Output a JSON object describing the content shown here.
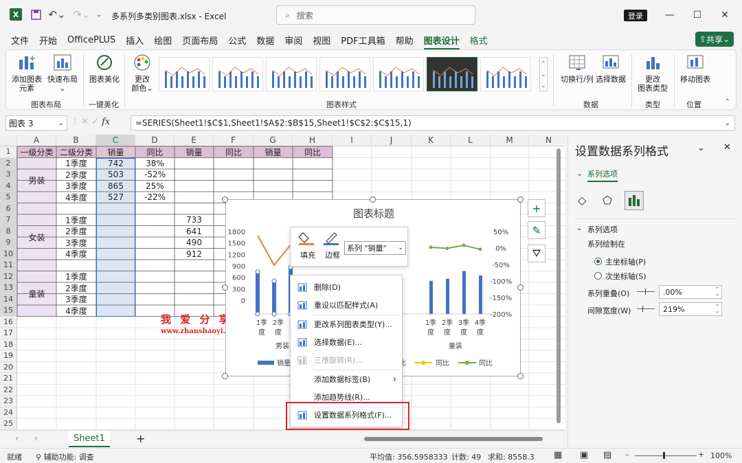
{
  "titlebar": {
    "app_icon": "excel-icon",
    "filename": "多系列多类别图表.xlsx",
    "separator": "-",
    "app_name": "Excel",
    "search_placeholder": "搜索",
    "login_label": "登录"
  },
  "menu": {
    "items": [
      "文件",
      "开始",
      "OfficePLUS",
      "插入",
      "绘图",
      "页面布局",
      "公式",
      "数据",
      "审阅",
      "视图",
      "PDF工具箱",
      "帮助",
      "图表设计",
      "格式"
    ],
    "active": "图表设计",
    "share_label": "共享"
  },
  "ribbon": {
    "add_element": [
      "添加图表",
      "元素"
    ],
    "quick_layout": [
      "快速布局"
    ],
    "beautify": [
      "图表美化"
    ],
    "change_color": [
      "更改",
      "颜色"
    ],
    "switch_rowcol": "切换行/列",
    "select_data": "选择数据",
    "change_type": [
      "更改",
      "图表类型"
    ],
    "move_chart": "移动图表",
    "groups": {
      "layout": "图表布局",
      "beautify": "一键美化",
      "styles": "图表样式",
      "data": "数据",
      "type": "类型",
      "location": "位置"
    }
  },
  "formula_bar": {
    "name_box": "图表 3",
    "fx": "fx",
    "formula": "=SERIES(Sheet1!$C$1,Sheet1!$A$2:$B$15,Sheet1!$C$2:$C$15,1)"
  },
  "sheet": {
    "columns": [
      "A",
      "B",
      "C",
      "D",
      "E",
      "F",
      "G",
      "H",
      "I",
      "J",
      "K",
      "L",
      "M",
      "N"
    ],
    "rows": [
      "1",
      "2",
      "3",
      "4",
      "5",
      "6",
      "7",
      "8",
      "9",
      "10",
      "11",
      "12",
      "13",
      "14",
      "15",
      "16",
      "17",
      "18",
      "19",
      "20",
      "21",
      "22",
      "23",
      "24",
      "25"
    ],
    "header": [
      "一级分类",
      "二级分类",
      "销量",
      "同比",
      "销量",
      "同比",
      "销量",
      "同比"
    ],
    "groups": [
      "男装",
      "女装",
      "童装"
    ],
    "quarters": [
      "1季度",
      "2季度",
      "3季度",
      "4季度"
    ],
    "men_sales": [
      "742",
      "503",
      "865",
      "527"
    ],
    "men_yoy": [
      "38%",
      "-52%",
      "25%",
      "-22%"
    ],
    "women_sales": [
      "733",
      "641",
      "490",
      "912"
    ],
    "watermark_cn": "我 爱 分 享 网",
    "watermark_url": "www.zhanshaoyi.com"
  },
  "chart_data": {
    "type": "bar",
    "title": "图表标题",
    "y_left_ticks": [
      "1800",
      "1500",
      "1200",
      "900",
      "600",
      "300",
      "0"
    ],
    "y_right_ticks": [
      "50%",
      "0%",
      "-50%",
      "-100%",
      "-150%",
      "-200%"
    ],
    "ylim": [
      0,
      1800
    ],
    "y2lim": [
      -2,
      0.5
    ],
    "category_groups": [
      "男装",
      "童装"
    ],
    "categories": [
      "1季",
      "2季",
      "3季",
      "4季"
    ],
    "categories_line2": "度",
    "series": [
      {
        "name": "销量",
        "color": "#4472c4",
        "values": [
          742,
          503,
          865,
          null
        ]
      },
      {
        "name": "同比",
        "color": "#ed7d31",
        "values": [
          0.38,
          -0.52,
          null,
          null
        ]
      },
      {
        "name": "销量",
        "color": "#4472c4",
        "values": [
          null,
          null,
          null,
          null
        ]
      },
      {
        "name": "同比",
        "color": "#ffc000",
        "values": [
          null,
          null,
          null,
          null
        ]
      },
      {
        "name": "同比",
        "color": "#70ad47",
        "values": [
          0.02,
          -0.01,
          0.08,
          -0.04
        ]
      }
    ],
    "legend_labels": [
      "销量",
      "比",
      "同比",
      "同比"
    ],
    "legend_position": "bottom"
  },
  "mini_toolbar": {
    "fill": "填充",
    "border": "边框",
    "series_select": "系列 \"销量\""
  },
  "context_menu": [
    {
      "label": "删除(D)",
      "icon": "delete-icon",
      "disabled": false
    },
    {
      "label": "重设以匹配样式(A)",
      "icon": "reset-style-icon",
      "disabled": false
    },
    {
      "label": "更改系列图表类型(Y)...",
      "icon": "chart-type-icon",
      "disabled": false
    },
    {
      "label": "选择数据(E)...",
      "icon": "select-data-icon",
      "disabled": false
    },
    {
      "label": "三维旋转(R)...",
      "icon": "rotate-3d-icon",
      "disabled": true
    },
    {
      "label": "添加数据标签(B)",
      "icon": "",
      "disabled": false
    },
    {
      "label": "添加趋势线(R)...",
      "icon": "",
      "disabled": false
    },
    {
      "label": "设置数据系列格式(F)...",
      "icon": "format-series-icon",
      "disabled": false
    }
  ],
  "pane": {
    "title": "设置数据系列格式",
    "section": "系列选项",
    "subsection": "系列选项",
    "plot_on": "系列绘制在",
    "primary_axis": "主坐标轴(P)",
    "secondary_axis": "次坐标轴(S)",
    "overlap_label": "系列重叠(O)",
    "overlap_value": ".00%",
    "gap_label": "间隙宽度(W)",
    "gap_value": "219%"
  },
  "tabs": {
    "sheet1": "Sheet1",
    "add": "+"
  },
  "status": {
    "ready": "就绪",
    "accessibility": "辅助功能: 调查",
    "average": "平均值: 356.5958333",
    "count": "计数: 49",
    "sum": "求和: 8558.3",
    "zoom": "100%"
  },
  "colors": {
    "accent": "#1e6b3a",
    "sales": "#4472c4",
    "yoy_orange": "#ed7d31",
    "yoy_green": "#70ad47",
    "highlight_red": "#d7262b"
  }
}
